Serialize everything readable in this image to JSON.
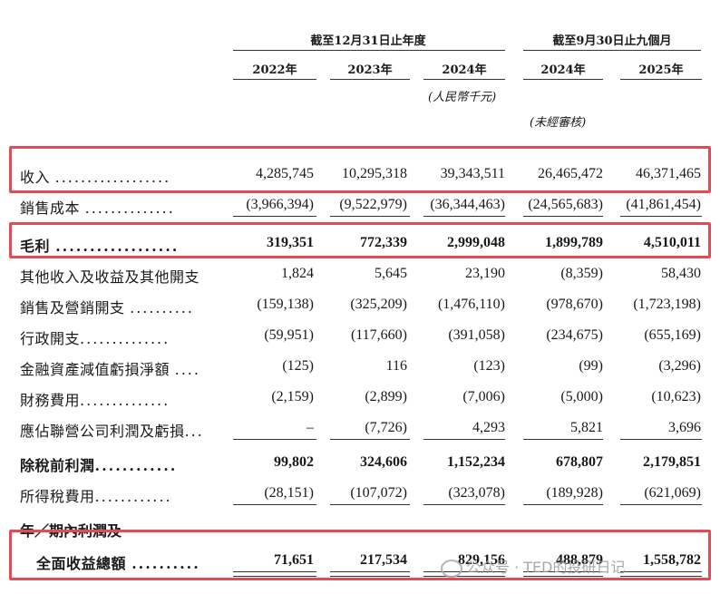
{
  "header": {
    "group1": "截至12月31日止年度",
    "group2": "截至9月30日止九個月",
    "years": [
      "2022年",
      "2023年",
      "2024年",
      "2024年",
      "2025年"
    ],
    "unit": "(人民幣千元)",
    "unaudited": "(未經審核)"
  },
  "rows": [
    {
      "label": "收入",
      "dots": "..................",
      "values": [
        "4,285,745",
        "10,295,318",
        "39,343,511",
        "26,465,472",
        "46,371,465"
      ],
      "bold": false
    },
    {
      "label": "銷售成本",
      "dots": "..............",
      "values": [
        "(3,966,394)",
        "(9,522,979)",
        "(36,344,463)",
        "(24,565,683)",
        "(41,861,454)"
      ],
      "bold": false
    },
    {
      "label": "毛利",
      "dots": "..................",
      "values": [
        "319,351",
        "772,339",
        "2,999,048",
        "1,899,789",
        "4,510,011"
      ],
      "bold": true
    },
    {
      "label": "其他收入及收益及其他開支",
      "dots": "",
      "values": [
        "1,824",
        "5,645",
        "23,190",
        "(8,359)",
        "58,430"
      ],
      "bold": false
    },
    {
      "label": "銷售及營銷開支",
      "dots": "..........",
      "values": [
        "(159,138)",
        "(325,209)",
        "(1,476,110)",
        "(978,670)",
        "(1,723,198)"
      ],
      "bold": false
    },
    {
      "label": "行政開支",
      "dots": "..............",
      "values": [
        "(59,951)",
        "(117,660)",
        "(391,058)",
        "(234,675)",
        "(655,169)"
      ],
      "bold": false
    },
    {
      "label": "金融資產減值虧損淨額",
      "dots": "....",
      "values": [
        "(125)",
        "116",
        "(123)",
        "(99)",
        "(3,296)"
      ],
      "bold": false
    },
    {
      "label": "財務費用",
      "dots": "..............",
      "values": [
        "(2,159)",
        "(2,899)",
        "(7,006)",
        "(5,000)",
        "(10,623)"
      ],
      "bold": false
    },
    {
      "label": "應佔聯營公司利潤及虧損",
      "dots": "...",
      "values": [
        "–",
        "(7,726)",
        "4,293",
        "5,821",
        "3,696"
      ],
      "bold": false
    },
    {
      "label": "除稅前利潤",
      "dots": "............",
      "values": [
        "99,802",
        "324,606",
        "1,152,234",
        "678,807",
        "2,179,851"
      ],
      "bold": true
    },
    {
      "label": "所得稅費用",
      "dots": "............",
      "values": [
        "(28,151)",
        "(107,072)",
        "(323,078)",
        "(189,928)",
        "(621,069)"
      ],
      "bold": false
    }
  ],
  "final": {
    "label_line1": "年／期內利潤及",
    "label_line2": "全面收益總額",
    "dots": "..........",
    "values": [
      "71,651",
      "217,534",
      "829,156",
      "488,879",
      "1,558,782"
    ]
  },
  "watermark": "公众号 · TED的投研日记",
  "colors": {
    "highlight": "#e24b55"
  }
}
